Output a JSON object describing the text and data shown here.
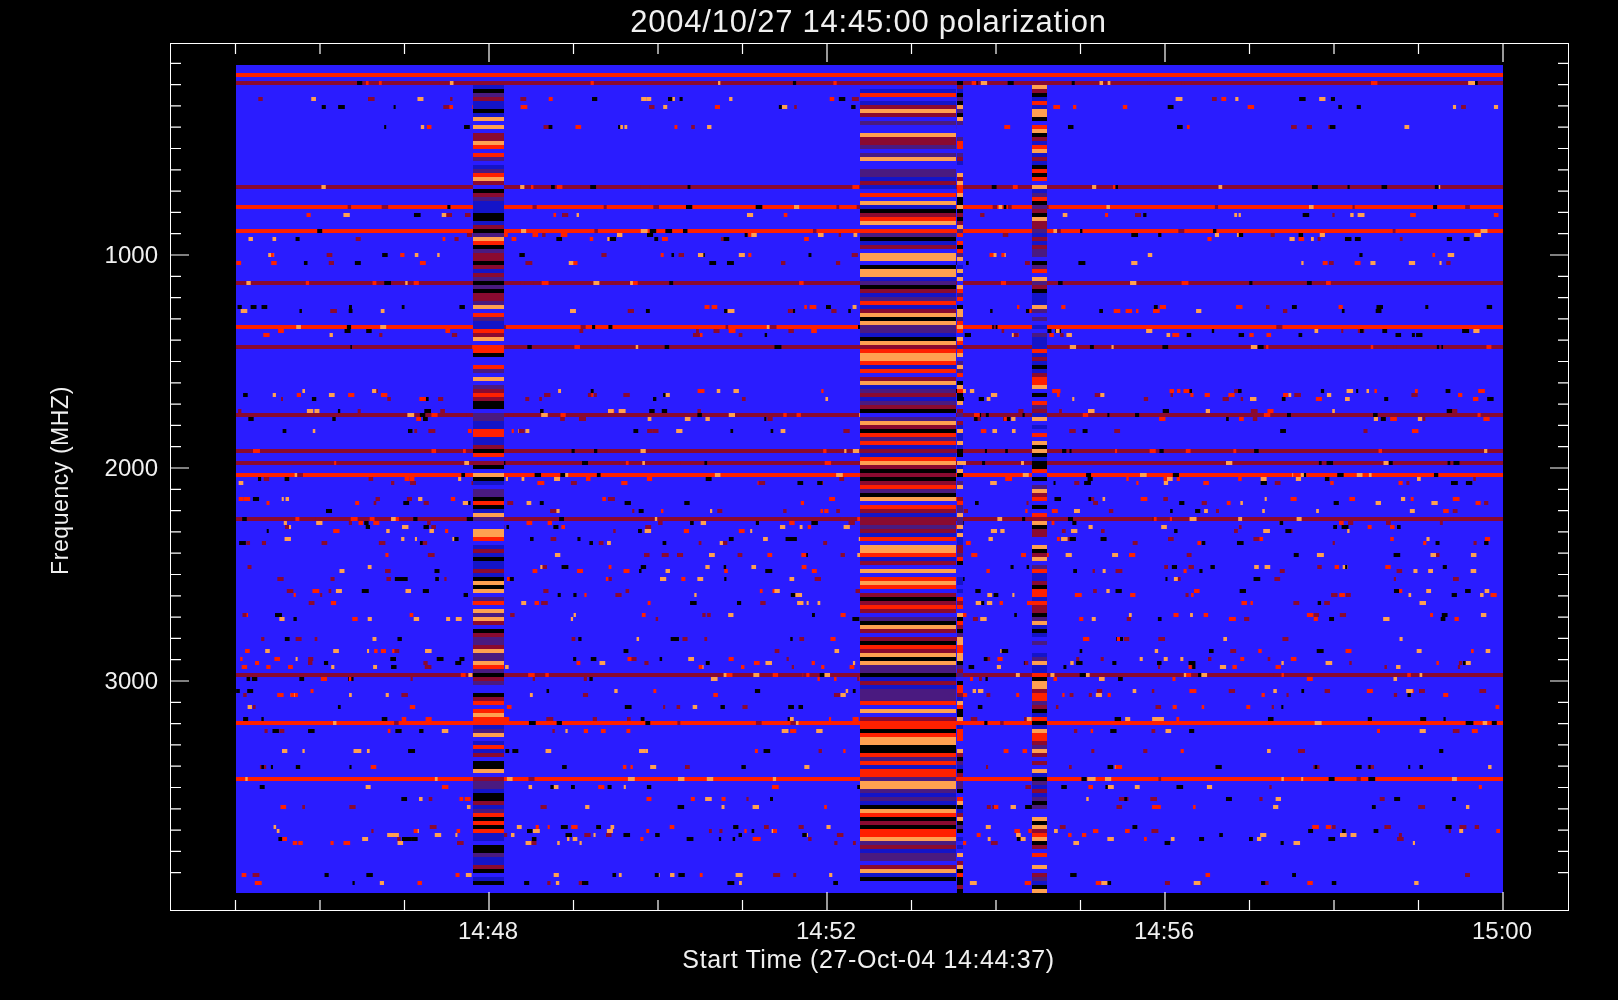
{
  "title": "2004/10/27 14:45:00 polarization",
  "y_axis": {
    "label": "Frequency (MHZ)",
    "ticks": [
      "1000",
      "2000",
      "3000"
    ]
  },
  "x_axis": {
    "label": "Start Time (27-Oct-04 14:44:37)",
    "ticks": [
      "14:48",
      "14:52",
      "14:56",
      "15:00"
    ]
  }
}
